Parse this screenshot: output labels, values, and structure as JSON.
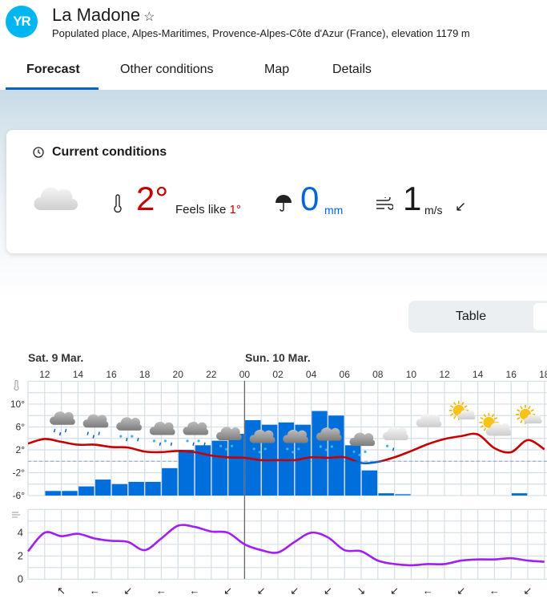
{
  "header": {
    "logo": "YR",
    "title": "La Madone",
    "favorite_icon": "star-outline-icon",
    "subtitle": "Populated place, Alpes-Maritimes, Provence-Alpes-Côte d'Azur (France), elevation 1179 m"
  },
  "tabs": [
    {
      "label": "Forecast",
      "active": true
    },
    {
      "label": "Other conditions"
    },
    {
      "label": "Map"
    },
    {
      "label": "Details"
    }
  ],
  "current": {
    "title": "Current conditions",
    "symbol": "cloudy",
    "temperature": "2°",
    "feels_like_label": "Feels like",
    "feels_like": "1°",
    "precipitation": "0",
    "precip_unit": "mm",
    "wind": "1",
    "wind_unit": "m/s",
    "wind_arrow": "↙"
  },
  "view_toggle": {
    "table_label": "Table"
  },
  "colors": {
    "accent": "#0066cc",
    "temp_warm": "#c60000",
    "temp_cold": "#0066cc",
    "precip": "#006edb",
    "wind": "#a11ff0"
  },
  "chart_data": {
    "type": "line+bar",
    "days": [
      "Sat. 9 Mar.",
      "Sun. 10 Mar."
    ],
    "hour_ticks": [
      "12",
      "14",
      "16",
      "18",
      "20",
      "22",
      "00",
      "02",
      "04",
      "06",
      "08",
      "10",
      "12",
      "14",
      "16",
      "18"
    ],
    "temperature": {
      "unit": "°",
      "ylim": [
        -6,
        14
      ],
      "tick_labels": [
        "10°",
        "6°",
        "2°",
        "-2°",
        "-6°"
      ],
      "hours": [
        "11",
        "12",
        "13",
        "14",
        "15",
        "16",
        "17",
        "18",
        "19",
        "20",
        "21",
        "22",
        "23",
        "00",
        "01",
        "02",
        "03",
        "04",
        "05",
        "06",
        "07",
        "08",
        "09",
        "10",
        "11",
        "12",
        "13",
        "14",
        "15",
        "16",
        "17",
        "18"
      ],
      "values": [
        3.1,
        3.9,
        3.4,
        2.9,
        2.9,
        2.5,
        2.4,
        1.7,
        1.6,
        1.8,
        1.6,
        1.0,
        0.7,
        0.6,
        0.2,
        0.2,
        0.2,
        0.7,
        0.6,
        0.7,
        -0.3,
        -0.1,
        0.7,
        1.8,
        3.0,
        3.9,
        4.4,
        4.7,
        2.3,
        1.6,
        3.7,
        2.1
      ]
    },
    "precipitation_mm": {
      "hours": [
        "12",
        "13",
        "14",
        "15",
        "16",
        "17",
        "18",
        "19",
        "20",
        "21",
        "22",
        "23",
        "00",
        "01",
        "02",
        "03",
        "04",
        "05",
        "06",
        "07",
        "08",
        "09",
        "10",
        "11",
        "12",
        "13",
        "14",
        "15",
        "16",
        "17"
      ],
      "values": [
        0.2,
        0.2,
        0.4,
        0.7,
        0.5,
        0.6,
        0.6,
        1.2,
        2.0,
        2.2,
        2.4,
        2.7,
        3.3,
        3.1,
        3.2,
        3.1,
        3.7,
        3.5,
        2.2,
        1.1,
        0.1,
        0.05,
        0,
        0,
        0,
        0,
        0,
        0,
        0.1,
        0
      ]
    },
    "wind": {
      "unit": "m/s",
      "ylim": [
        0,
        6
      ],
      "tick_labels": [
        "4",
        "2",
        "0"
      ],
      "values": [
        2.4,
        4.0,
        3.7,
        3.9,
        3.5,
        3.3,
        3.2,
        2.5,
        3.5,
        4.6,
        4.5,
        4.1,
        4.0,
        3.0,
        2.5,
        2.3,
        3.2,
        4.0,
        3.6,
        2.5,
        2.4,
        1.6,
        1.3,
        1.2,
        1.3,
        1.3,
        1.6,
        1.7,
        1.7,
        1.8,
        1.6,
        1.5
      ],
      "arrows": [
        "↖",
        "←",
        "↙",
        "←",
        "←",
        "↙",
        "↙",
        "↙",
        "↙",
        "↘",
        "↙",
        "←",
        "↙",
        "←",
        "↙"
      ]
    },
    "symbols": [
      "rain",
      "rain",
      "sleet",
      "sleet",
      "sleet",
      "snow-showers",
      "snow",
      "snow",
      "snow",
      "snow",
      "light-sleet",
      "cloudy",
      "partly-sunny",
      "partly-cloudy",
      "partly-sunny"
    ]
  }
}
